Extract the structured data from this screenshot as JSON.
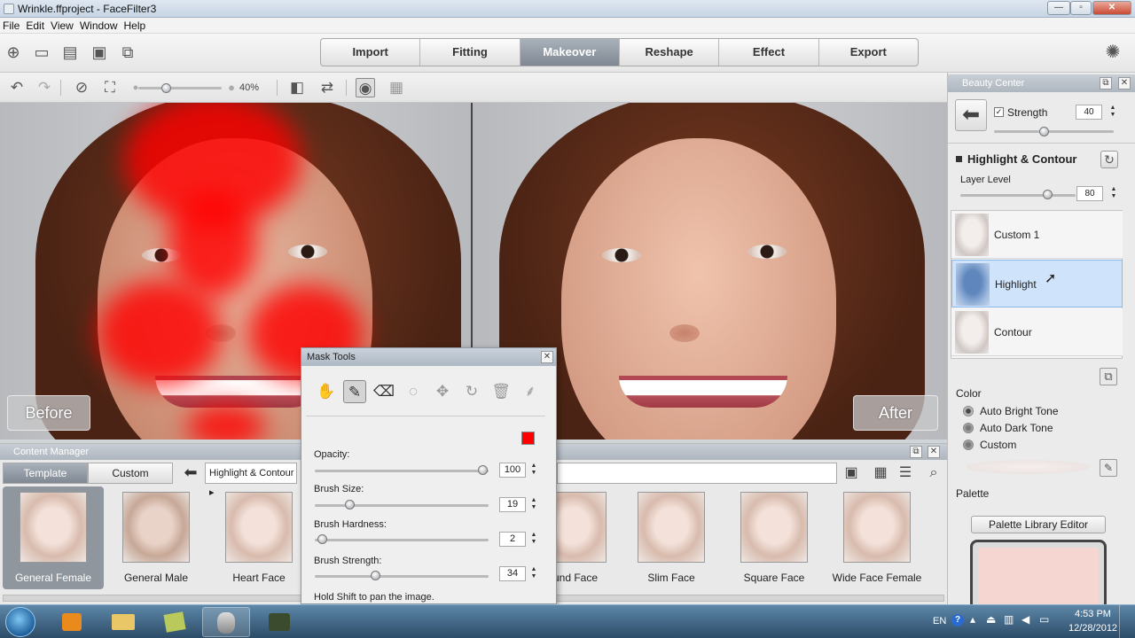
{
  "window": {
    "title": "Wrinkle.ffproject - FaceFilter3",
    "min": "—",
    "max": "▫",
    "close": "✕"
  },
  "menu": [
    "File",
    "Edit",
    "View",
    "Window",
    "Help"
  ],
  "steps": [
    {
      "label": "Import",
      "active": false
    },
    {
      "label": "Fitting",
      "active": false
    },
    {
      "label": "Makeover",
      "active": true
    },
    {
      "label": "Reshape",
      "active": false
    },
    {
      "label": "Effect",
      "active": false
    },
    {
      "label": "Export",
      "active": false
    }
  ],
  "viewer": {
    "zoom": "40%",
    "before_label": "Before",
    "after_label": "After"
  },
  "beauty_center": {
    "title": "Beauty Center",
    "strength_label": "Strength",
    "strength_value": "40",
    "strength_checked": true,
    "section_title": "Highlight & Contour",
    "layer_level_label": "Layer Level",
    "layer_level_value": "80",
    "layers": [
      {
        "label": "Custom 1",
        "selected": false
      },
      {
        "label": "Highlight",
        "selected": true
      },
      {
        "label": "Contour",
        "selected": false
      }
    ],
    "color_label": "Color",
    "color_options": [
      "Auto Bright Tone",
      "Auto Dark Tone",
      "Custom"
    ],
    "palette_label": "Palette",
    "palette_button": "Palette Library Editor",
    "palette_swatch": "#f5d6d1"
  },
  "content_manager": {
    "title": "Content Manager",
    "tabs": [
      {
        "label": "Template",
        "active": true
      },
      {
        "label": "Custom",
        "active": false
      }
    ],
    "breadcrumb": "Highlight & Contour",
    "templates_left": [
      {
        "label": "General Female",
        "selected": true
      },
      {
        "label": "General Male",
        "selected": false
      },
      {
        "label": "Heart Face",
        "selected": false
      }
    ],
    "templates_right": [
      {
        "label": "und Face"
      },
      {
        "label": "Slim Face"
      },
      {
        "label": "Square Face"
      },
      {
        "label": "Wide Face Female"
      }
    ]
  },
  "mask_tools": {
    "title": "Mask Tools",
    "close": "✕",
    "color": "#ff0000",
    "opacity_label": "Opacity:",
    "opacity_value": "100",
    "opacity": 1.0,
    "brush_size_label": "Brush Size:",
    "brush_size_value": "19",
    "brush_hardness_label": "Brush Hardness:",
    "brush_hardness_value": "2",
    "brush_strength_label": "Brush Strength:",
    "brush_strength_value": "34",
    "hint": "Hold Shift to pan the image."
  },
  "taskbar": {
    "lang": "EN",
    "time": "4:53 PM",
    "date": "12/28/2012"
  }
}
